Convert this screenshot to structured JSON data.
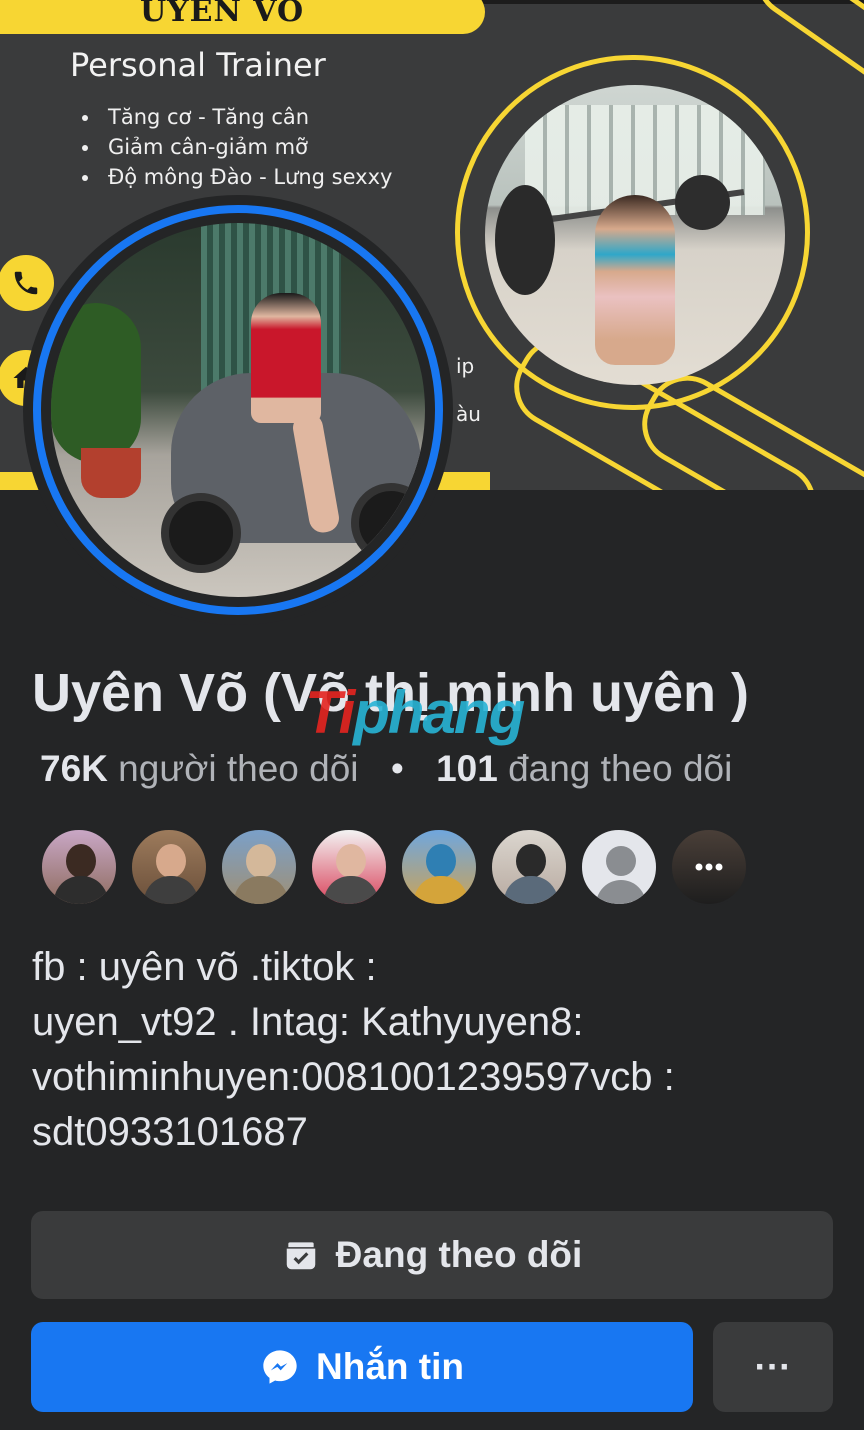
{
  "cover": {
    "name": "UYÊN VÕ",
    "subtitle": "Personal Trainer",
    "bullets": [
      "Tăng cơ - Tăng cân",
      "Giảm cân-giảm mỡ",
      "Độ mông Đào - Lưng sexxy"
    ],
    "side_text_1": "ip",
    "side_text_2": "àu",
    "accent": "#f7d633"
  },
  "profile": {
    "name": "Uyên Võ (Võ thị minh uyên )",
    "followers_count": "76K",
    "followers_label": "người theo dõi",
    "separator": "•",
    "following_count": "101",
    "following_label": "đang theo dõi",
    "watermark_part1": "Ti",
    "watermark_part2": "phang"
  },
  "friends": [
    {
      "id": "friend-1"
    },
    {
      "id": "friend-2"
    },
    {
      "id": "friend-3"
    },
    {
      "id": "friend-4"
    },
    {
      "id": "friend-5"
    },
    {
      "id": "friend-6"
    },
    {
      "id": "friend-7"
    },
    {
      "id": "friend-8"
    }
  ],
  "bio": "fb : uyên võ .tiktok :\nuyen_vt92 . Intag: Kathyuyen8:\nvothiminhuyen:0081001239597vcb :\nsdt0933101687",
  "actions": {
    "following_label": "Đang theo dõi",
    "message_label": "Nhắn tin",
    "more_label": "···",
    "primary_color": "#1877f2"
  }
}
